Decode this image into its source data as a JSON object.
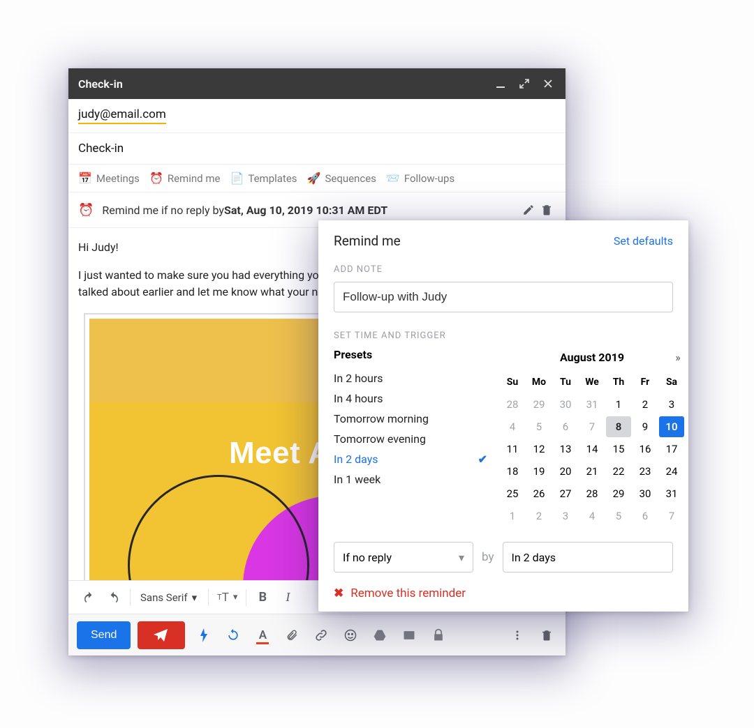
{
  "compose": {
    "title": "Check-in",
    "to": "judy@email.com",
    "subject": "Check-in",
    "toolbar": {
      "meetings": "Meetings",
      "remind_me": "Remind me",
      "templates": "Templates",
      "sequences": "Sequences",
      "follow_ups": "Follow-ups"
    },
    "reminder_prefix": "Remind me if no reply by ",
    "reminder_date": "Sat, Aug 10, 2019 10:31 AM EDT",
    "body_line1": "Hi Judy!",
    "body_line2": "I just wanted to make sure you had everything you need for Friday. Please take a look at what we talked about earlier and let me know what your next steps are.",
    "embed_text": "Meet Aw",
    "font_label": "Sans Serif",
    "send_label": "Send"
  },
  "panel": {
    "title": "Remind me",
    "set_defaults": "Set defaults",
    "add_note_label": "ADD NOTE",
    "note_value": "Follow-up with Judy",
    "section_label": "SET TIME AND TRIGGER",
    "presets_title": "Presets",
    "presets": [
      {
        "label": "In 2 hours",
        "selected": false
      },
      {
        "label": "In 4 hours",
        "selected": false
      },
      {
        "label": "Tomorrow morning",
        "selected": false
      },
      {
        "label": "Tomorrow evening",
        "selected": false
      },
      {
        "label": "In 2 days",
        "selected": true
      },
      {
        "label": "In 1 week",
        "selected": false
      }
    ],
    "calendar": {
      "month_label": "August 2019",
      "dow": [
        "Su",
        "Mo",
        "Tu",
        "We",
        "Th",
        "Fr",
        "Sa"
      ],
      "grid": [
        {
          "d": 28,
          "muted": true
        },
        {
          "d": 29,
          "muted": true
        },
        {
          "d": 30,
          "muted": true
        },
        {
          "d": 31,
          "muted": true
        },
        {
          "d": 1
        },
        {
          "d": 2
        },
        {
          "d": 3
        },
        {
          "d": 4,
          "muted": true
        },
        {
          "d": 5,
          "muted": true
        },
        {
          "d": 6,
          "muted": true
        },
        {
          "d": 7,
          "muted": true
        },
        {
          "d": 8,
          "today": true
        },
        {
          "d": 9
        },
        {
          "d": 10,
          "selected": true
        },
        {
          "d": 11
        },
        {
          "d": 12
        },
        {
          "d": 13
        },
        {
          "d": 14
        },
        {
          "d": 15
        },
        {
          "d": 16
        },
        {
          "d": 17
        },
        {
          "d": 18
        },
        {
          "d": 19
        },
        {
          "d": 20
        },
        {
          "d": 21
        },
        {
          "d": 22
        },
        {
          "d": 23
        },
        {
          "d": 24
        },
        {
          "d": 25
        },
        {
          "d": 26
        },
        {
          "d": 27
        },
        {
          "d": 28
        },
        {
          "d": 29
        },
        {
          "d": 30
        },
        {
          "d": 31
        },
        {
          "d": 1,
          "muted": true
        },
        {
          "d": 2,
          "muted": true
        },
        {
          "d": 3,
          "muted": true
        },
        {
          "d": 4,
          "muted": true
        },
        {
          "d": 5,
          "muted": true
        },
        {
          "d": 6,
          "muted": true
        },
        {
          "d": 7,
          "muted": true
        }
      ]
    },
    "trigger_select": "If no reply",
    "by_label": "by",
    "delay_value": "In 2 days",
    "remove_label": "Remove this reminder"
  }
}
